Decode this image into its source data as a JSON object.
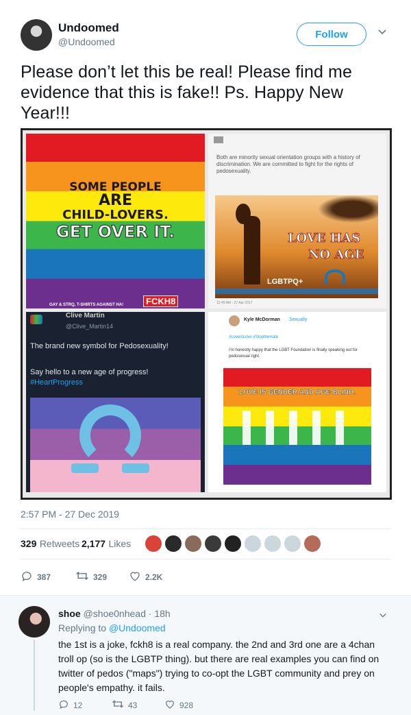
{
  "author": {
    "name": "Undoomed",
    "handle": "@Undoomed"
  },
  "follow_label": "Follow",
  "tweet": {
    "text": "Please don’t let this be real! Please find me evidence that this is fake!! Ps. Happy New Year!!!",
    "timestamp": "2:57 PM - 27 Dec 2019",
    "retweets": "329",
    "retweets_label": "Retweets",
    "likes": "2,177",
    "likes_label": "Likes",
    "actions": {
      "replies": "387",
      "retweets": "329",
      "likes": "2.2K"
    }
  },
  "media": {
    "panel1": {
      "line1": "SOME PEOPLE",
      "line2": "ARE",
      "line3": "CHILD-LOVERS.",
      "line4": "GET OVER IT.",
      "footer": "GAY & STRQ, T-SHIRTS AGAINST HA!",
      "brand": "FCKH8"
    },
    "panel2": {
      "text": "Both are minority sexual orientation groups with a history of discrimination. We are committed to fight for the rights of pedosexuality.",
      "banner1": "LOVE HAS",
      "banner2": "NO AGE",
      "tag": "LGBTPQ+",
      "date": "12:49 AM - 27 Apr 2017"
    },
    "panel3": {
      "name": "Clive Martin",
      "handle": "@Clive_Martin14",
      "line1": "The brand new symbol for Pedosexuality!",
      "line2": "Say hello to a new age of progress!",
      "hashtag": "#HeartProgress"
    },
    "panel4": {
      "name": "Kyle McDorman",
      "sub": "Sexually",
      "tags": "#LoveisLove #StoptheHate",
      "text": "I'm honestly happy that the LGBT Foundation is finally speaking out for pedosexual right.",
      "banner": "LOVE IS GENDER AND AGE-BLIND."
    }
  },
  "reply": {
    "name": "shoe",
    "handle": "@shoe0nhead",
    "time": "· 18h",
    "replying_prefix": "Replying to",
    "replying_to": "@Undoomed",
    "text": "the 1st is a joke, fckh8 is a real company. the 2nd and 3rd one are a 4chan troll op (so is the LGBTP thing). but there are real examples you can find on twitter of pedos (\"maps\") trying to co-opt the LGBT community and prey on people's empathy. it fails.",
    "actions": {
      "replies": "12",
      "retweets": "43",
      "likes": "928"
    }
  },
  "colors": {
    "accent": "#1da1f2",
    "text": "#14171a",
    "muted": "#657786"
  }
}
